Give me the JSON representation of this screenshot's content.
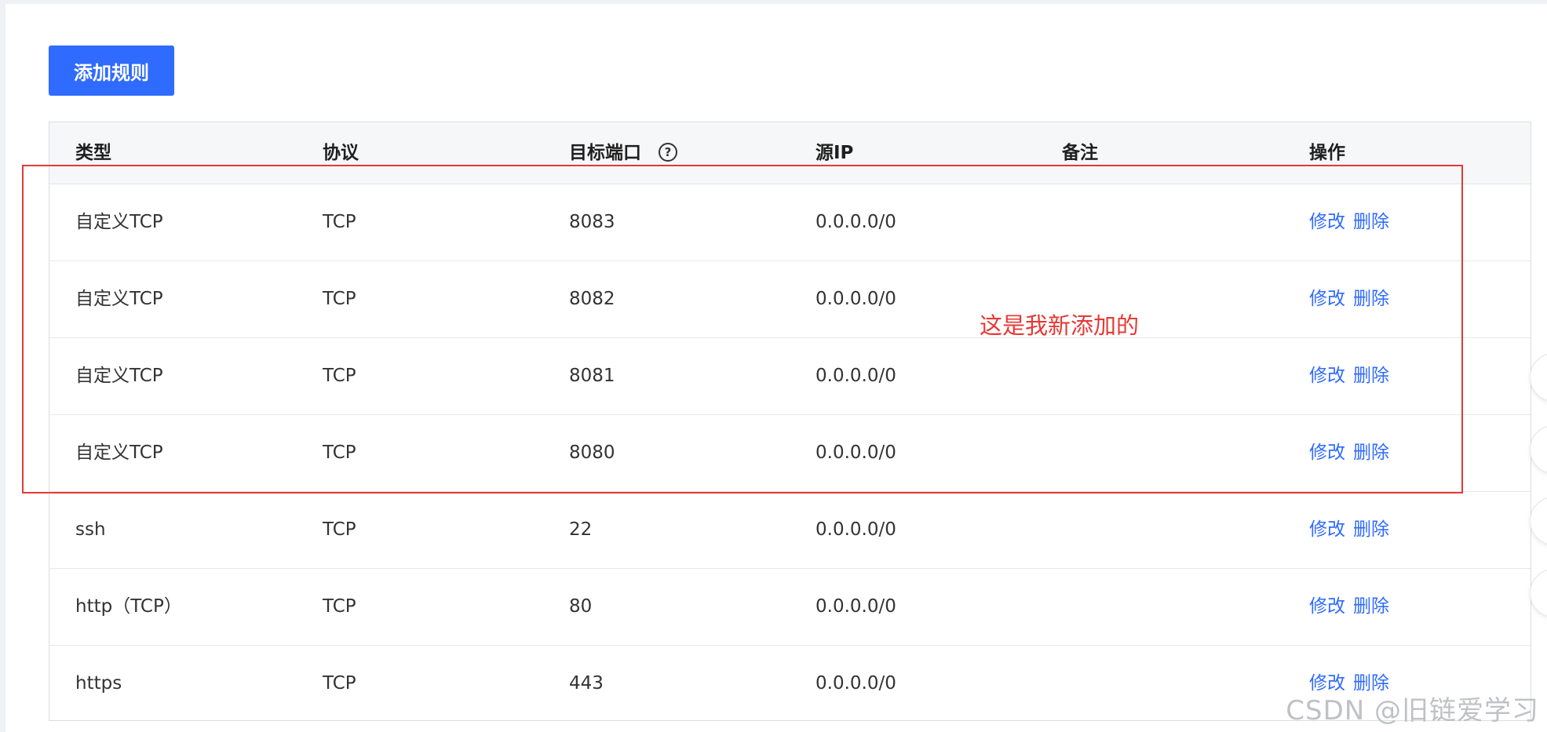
{
  "toolbar": {
    "add_rule_label": "添加规则"
  },
  "table": {
    "headers": {
      "type": "类型",
      "protocol": "协议",
      "target_port": "目标端口",
      "source_ip": "源IP",
      "remark": "备注",
      "actions": "操作"
    },
    "help_icon_glyph": "?",
    "rows": [
      {
        "type": "自定义TCP",
        "protocol": "TCP",
        "port": "8083",
        "source_ip": "0.0.0.0/0",
        "remark": "",
        "edit": "修改",
        "delete": "删除"
      },
      {
        "type": "自定义TCP",
        "protocol": "TCP",
        "port": "8082",
        "source_ip": "0.0.0.0/0",
        "remark": "",
        "edit": "修改",
        "delete": "删除"
      },
      {
        "type": "自定义TCP",
        "protocol": "TCP",
        "port": "8081",
        "source_ip": "0.0.0.0/0",
        "remark": "",
        "edit": "修改",
        "delete": "删除"
      },
      {
        "type": "自定义TCP",
        "protocol": "TCP",
        "port": "8080",
        "source_ip": "0.0.0.0/0",
        "remark": "",
        "edit": "修改",
        "delete": "删除"
      },
      {
        "type": "ssh",
        "protocol": "TCP",
        "port": "22",
        "source_ip": "0.0.0.0/0",
        "remark": "",
        "edit": "修改",
        "delete": "删除"
      },
      {
        "type": "http（TCP）",
        "protocol": "TCP",
        "port": "80",
        "source_ip": "0.0.0.0/0",
        "remark": "",
        "edit": "修改",
        "delete": "删除"
      },
      {
        "type": "https",
        "protocol": "TCP",
        "port": "443",
        "source_ip": "0.0.0.0/0",
        "remark": "",
        "edit": "修改",
        "delete": "删除"
      }
    ]
  },
  "annotation": {
    "text": "这是我新添加的",
    "color": "#e53935"
  },
  "watermark": "CSDN @旧链爱学习",
  "colors": {
    "primary": "#2f6bff",
    "annotation_red": "#e53935"
  }
}
